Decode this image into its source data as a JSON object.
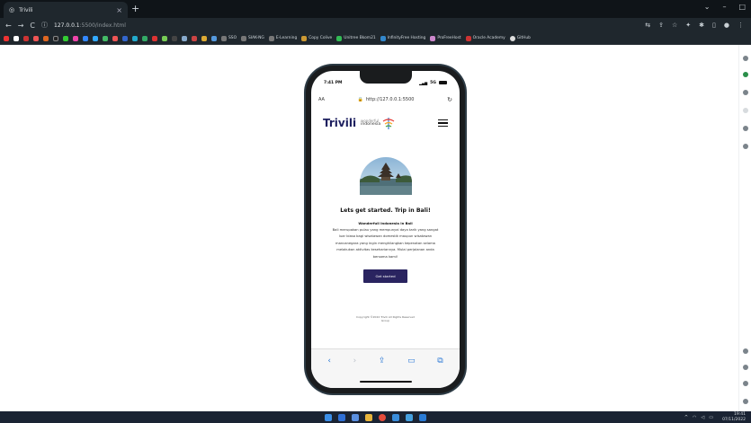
{
  "browser": {
    "tab_title": "Trivili",
    "url_host": "127.0.0.1",
    "url_path": ":5500/index.html",
    "bookmarks": [
      "SSO",
      "SIAK-NG",
      "E-Learning",
      "Copy Colive",
      "Unitree Bkom21",
      "InfinityFree Hosting",
      "ProFreeHost",
      "Oracle Academy",
      "GitHub"
    ],
    "colors": {
      "chrome_bg": "#1f272d",
      "tab_bg": "#0f1418",
      "taskbar": "#1a2333"
    }
  },
  "phone": {
    "time": "7:41 PM",
    "signal": "5G",
    "safari_aa": "AA",
    "safari_url": "http://127.0.0.1:5500",
    "reload_icon": "reload-icon"
  },
  "site": {
    "brand": "Trivili",
    "partner_line1": "wonderful",
    "partner_line2": "indonesia",
    "heading": "Lets get started. Trip in Bali!",
    "subheading": "Wonderfull Indonesia in Bali",
    "description": "Bali merupakan pulau yang mempunyai daya tarik yang sangat luar biasa bagi wisatawan domestik maupun wisatawan mancanegara yang ingin menghilangkan kepenatan selama melakukan aktivitas kesehariannya. Mulai perjalanan anda bersama kami!",
    "cta_label": "Get started",
    "footer_copyright": "Copyright ©2022 Trivili All Rights Reserved",
    "footer_link": "Group",
    "accent_color": "#2a2460"
  },
  "taskbar": {
    "time": "19:41",
    "date": "07/11/2022"
  }
}
